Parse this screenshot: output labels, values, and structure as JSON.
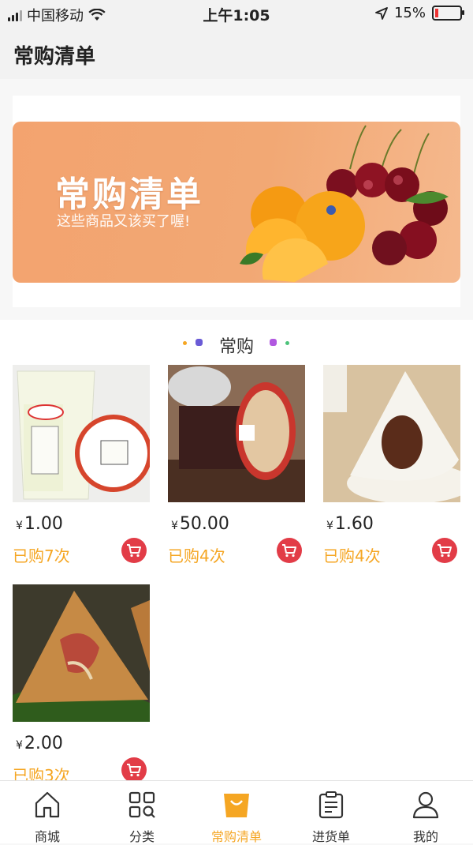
{
  "status_bar": {
    "carrier": "中国移动",
    "time": "上午1:05",
    "battery": "15%",
    "battery_level": 0.15
  },
  "header": {
    "title": "常购清单"
  },
  "banner": {
    "title": "常购清单",
    "subtitle": "这些商品又该买了喔!"
  },
  "section": {
    "title": "常购"
  },
  "products": [
    {
      "price": "1.00",
      "currency": "¥",
      "bought": "已购7次"
    },
    {
      "price": "50.00",
      "currency": "¥",
      "bought": "已购4次"
    },
    {
      "price": "1.60",
      "currency": "¥",
      "bought": "已购4次"
    },
    {
      "price": "2.00",
      "currency": "¥",
      "bought": "已购3次"
    }
  ],
  "tabbar": {
    "items": [
      {
        "label": "商城",
        "icon": "home-icon"
      },
      {
        "label": "分类",
        "icon": "category-icon"
      },
      {
        "label": "常购清单",
        "icon": "bag-icon",
        "active": true
      },
      {
        "label": "进货单",
        "icon": "clipboard-icon"
      },
      {
        "label": "我的",
        "icon": "user-icon"
      }
    ]
  },
  "colors": {
    "accent": "#f5a623",
    "cart": "#e23c47",
    "banner": "#f2a874"
  }
}
